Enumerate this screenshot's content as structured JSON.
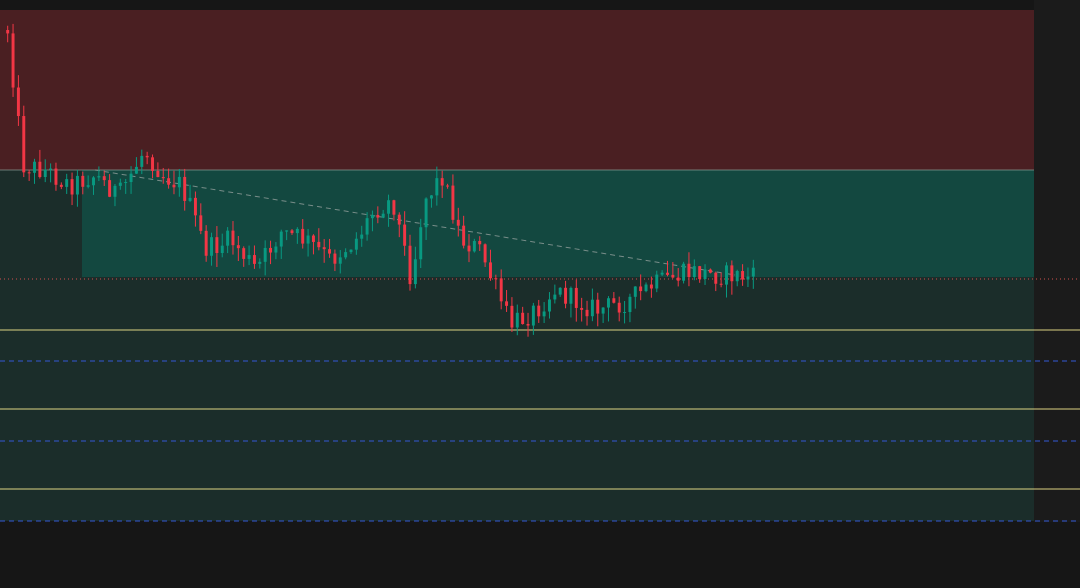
{
  "chart_data": {
    "type": "candlestick",
    "colors": {
      "background": "#161616",
      "bullish": "#089981",
      "bearish": "#f23645",
      "stop_zone": "#4a1f22",
      "target_zone": "#134840",
      "lower_zone": "#1b2d2a",
      "right_panel": "#1b1b1b",
      "trendline": "#8a9a96",
      "level_solid": "#f0e68c",
      "level_dashed": "#3358d4",
      "price_line": "#d0504e"
    },
    "y_range": [
      0,
      588
    ],
    "candle_count": 140,
    "anchor_path": [
      [
        0,
        30
      ],
      [
        5,
        165
      ],
      [
        12,
        170
      ],
      [
        20,
        185
      ],
      [
        28,
        175
      ],
      [
        36,
        195
      ],
      [
        44,
        150
      ],
      [
        50,
        175
      ],
      [
        56,
        185
      ],
      [
        64,
        250
      ],
      [
        72,
        240
      ],
      [
        80,
        270
      ],
      [
        88,
        232
      ],
      [
        96,
        240
      ],
      [
        104,
        260
      ],
      [
        112,
        240
      ],
      [
        118,
        210
      ],
      [
        124,
        200
      ],
      [
        130,
        280
      ],
      [
        134,
        200
      ],
      [
        140,
        175
      ],
      [
        146,
        240
      ],
      [
        152,
        250
      ],
      [
        162,
        325
      ],
      [
        170,
        310
      ],
      [
        176,
        290
      ],
      [
        182,
        300
      ],
      [
        190,
        310
      ],
      [
        200,
        300
      ],
      [
        208,
        285
      ],
      [
        212,
        280
      ],
      [
        220,
        272
      ],
      [
        228,
        275
      ],
      [
        234,
        275
      ],
      [
        240,
        278
      ]
    ],
    "zones": {
      "stop": {
        "top": 10,
        "bottom": 170
      },
      "target": {
        "top": 170,
        "bottom": 277
      }
    },
    "trendline": {
      "from": 170,
      "to": 275
    },
    "current_price": 279,
    "levels_solid": [
      330,
      409,
      489
    ],
    "levels_dashed": [
      361,
      441,
      521
    ]
  }
}
